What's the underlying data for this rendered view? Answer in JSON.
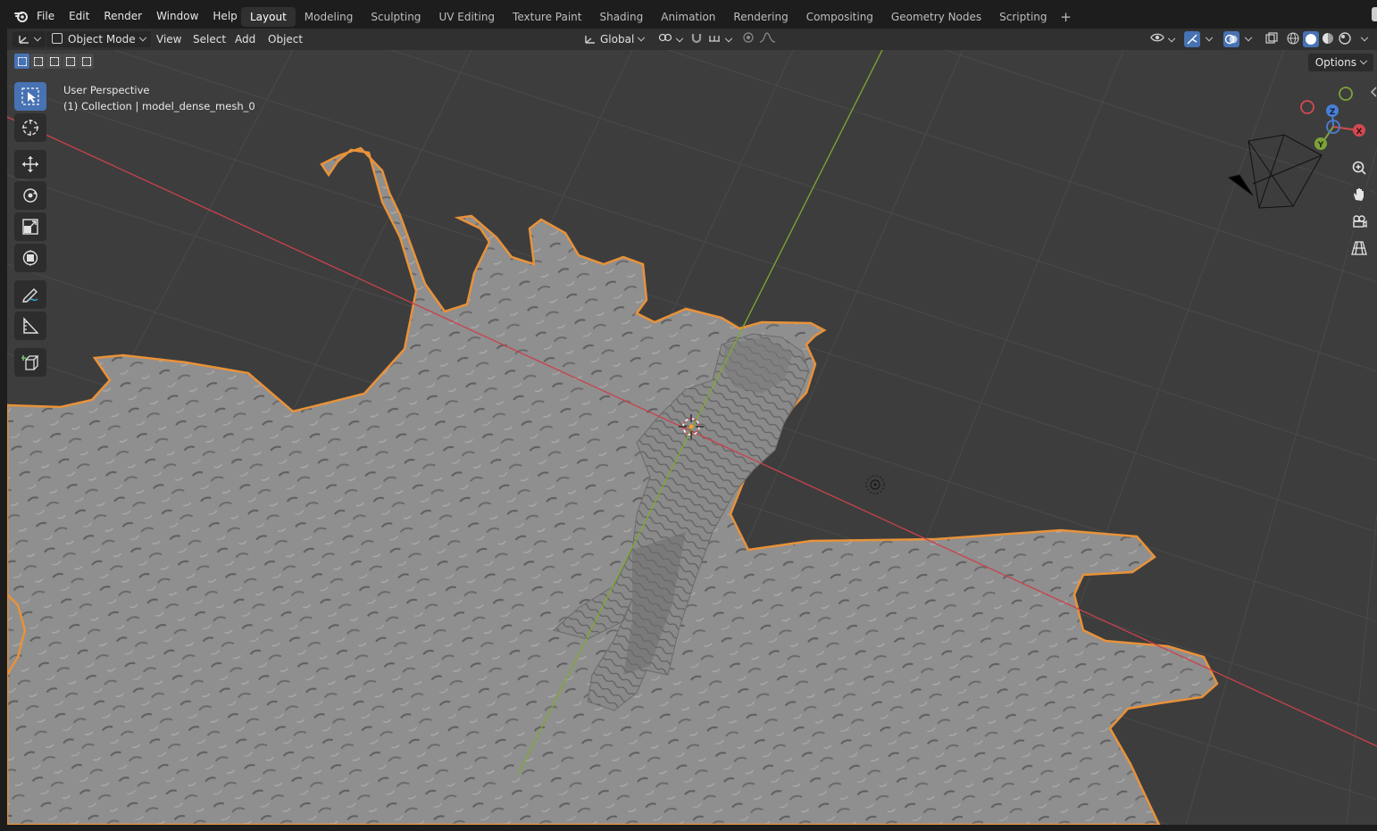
{
  "app": {
    "menu": [
      {
        "id": "file",
        "label": "File"
      },
      {
        "id": "edit",
        "label": "Edit"
      },
      {
        "id": "render",
        "label": "Render"
      },
      {
        "id": "window",
        "label": "Window"
      },
      {
        "id": "help",
        "label": "Help"
      }
    ],
    "workspaces": [
      {
        "id": "layout",
        "label": "Layout",
        "active": true
      },
      {
        "id": "modeling",
        "label": "Modeling"
      },
      {
        "id": "sculpting",
        "label": "Sculpting"
      },
      {
        "id": "uv-editing",
        "label": "UV Editing"
      },
      {
        "id": "texture-paint",
        "label": "Texture Paint"
      },
      {
        "id": "shading",
        "label": "Shading"
      },
      {
        "id": "animation",
        "label": "Animation"
      },
      {
        "id": "rendering",
        "label": "Rendering"
      },
      {
        "id": "compositing",
        "label": "Compositing"
      },
      {
        "id": "geometry-nodes",
        "label": "Geometry Nodes"
      },
      {
        "id": "scripting",
        "label": "Scripting"
      }
    ],
    "add_workspace": "+"
  },
  "header": {
    "mode": "Object Mode",
    "menus": [
      {
        "id": "view",
        "label": "View"
      },
      {
        "id": "select",
        "label": "Select"
      },
      {
        "id": "add",
        "label": "Add"
      },
      {
        "id": "object",
        "label": "Object"
      }
    ],
    "transform_orientation": "Global"
  },
  "viewport": {
    "perspective": "User Perspective",
    "collection_line": "(1) Collection | model_dense_mesh_0",
    "options_label": "Options",
    "gizmo": {
      "x": "X",
      "y": "Y",
      "z": "Z"
    }
  },
  "colors": {
    "accent": "#4772b3",
    "selection_outline": "#e8923a",
    "x_axis": "#d24a52",
    "y_axis": "#7da23a",
    "z_axis": "#4a7fd6",
    "viewport_bg": "#3d3d3d",
    "mesh": "#8f8f8f"
  },
  "tools": [
    {
      "id": "select-box",
      "icon": "cursor-select-icon",
      "active": true
    },
    {
      "id": "cursor",
      "icon": "3d-cursor-icon"
    },
    {
      "id": "move",
      "icon": "move-icon"
    },
    {
      "id": "rotate",
      "icon": "rotate-icon"
    },
    {
      "id": "scale",
      "icon": "scale-icon"
    },
    {
      "id": "transform",
      "icon": "transform-icon"
    },
    {
      "id": "annotate",
      "icon": "annotate-icon"
    },
    {
      "id": "measure",
      "icon": "measure-icon"
    },
    {
      "id": "add-cube",
      "icon": "add-cube-icon"
    }
  ]
}
